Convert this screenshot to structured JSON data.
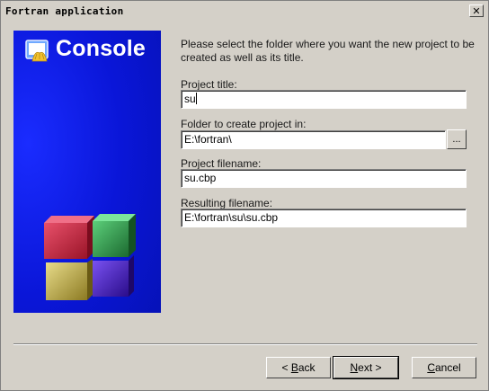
{
  "window": {
    "title": "Fortran application",
    "close_glyph": "✕"
  },
  "side_panel": {
    "brand_text": "Console",
    "logo_icon": "console-app-icon"
  },
  "intro_text": "Please select the folder where you want the new project to be created as well as its title.",
  "fields": {
    "project_title": {
      "label": "Project title:",
      "value": "su"
    },
    "folder": {
      "label": "Folder to create project in:",
      "value": "E:\\fortran\\"
    },
    "project_filename": {
      "label": "Project filename:",
      "value": "su.cbp"
    },
    "resulting_filename": {
      "label": "Resulting filename:",
      "value": "E:\\fortran\\su\\su.cbp"
    }
  },
  "browse_label": "...",
  "buttons": {
    "back": {
      "prefix": "< ",
      "accel": "B",
      "rest": "ack"
    },
    "next": {
      "accel": "N",
      "rest": "ext >"
    },
    "cancel": {
      "accel": "C",
      "rest": "ancel"
    }
  },
  "colors": {
    "dialog_bg": "#d4d0c8",
    "panel_blue": "#0a16d8",
    "cube_red": "#c8243c",
    "cube_green": "#2e9a4a",
    "cube_yellow": "#c8b84a",
    "cube_purple": "#4a22c8"
  }
}
